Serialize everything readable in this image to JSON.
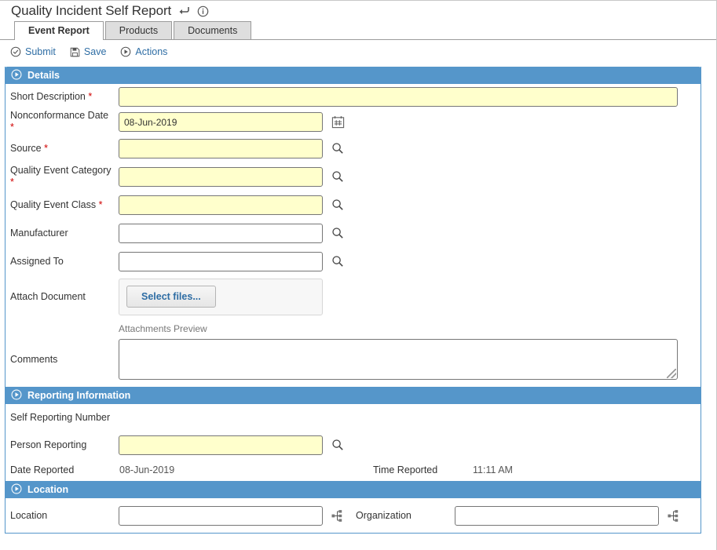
{
  "header": {
    "title": "Quality Incident Self Report",
    "icons": [
      {
        "name": "return-icon"
      },
      {
        "name": "info-icon"
      }
    ]
  },
  "tabs": [
    {
      "label": "Event Report",
      "active": true
    },
    {
      "label": "Products",
      "active": false
    },
    {
      "label": "Documents",
      "active": false
    }
  ],
  "toolbar": {
    "submit_label": "Submit",
    "save_label": "Save",
    "actions_label": "Actions"
  },
  "sections": {
    "details": {
      "title": "Details",
      "short_description": {
        "label": "Short Description",
        "required": true,
        "value": "",
        "picker": null
      },
      "nonconformance_date": {
        "label": "Nonconformance Date",
        "required": true,
        "value": "08-Jun-2019",
        "picker": "calendar-icon"
      },
      "source": {
        "label": "Source",
        "required": true,
        "value": "",
        "picker": "search-icon"
      },
      "quality_event_category": {
        "label": "Quality Event Category",
        "required": true,
        "value": "",
        "picker": "search-icon"
      },
      "quality_event_class": {
        "label": "Quality Event Class",
        "required": true,
        "value": "",
        "picker": "search-icon"
      },
      "manufacturer": {
        "label": "Manufacturer",
        "required": false,
        "value": "",
        "picker": "search-icon"
      },
      "assigned_to": {
        "label": "Assigned To",
        "required": false,
        "value": "",
        "picker": "search-icon"
      },
      "attach_document": {
        "label": "Attach Document",
        "button_label": "Select files..."
      },
      "attachments_preview": {
        "label": "Attachments Preview"
      },
      "comments": {
        "label": "Comments",
        "value": ""
      }
    },
    "reporting": {
      "title": "Reporting Information",
      "self_reporting_number": {
        "label": "Self Reporting Number",
        "value": ""
      },
      "person_reporting": {
        "label": "Person Reporting",
        "required": true,
        "value": "",
        "picker": "search-icon"
      },
      "date_reported": {
        "label": "Date Reported",
        "value": "08-Jun-2019"
      },
      "time_reported": {
        "label": "Time Reported",
        "value": "11:11 AM"
      }
    },
    "location": {
      "title": "Location",
      "location": {
        "label": "Location",
        "value": "",
        "picker": "tree-picker-icon"
      },
      "organization": {
        "label": "Organization",
        "value": "",
        "picker": "tree-picker-icon"
      }
    }
  },
  "colors": {
    "section_header_blue": "#5596ca",
    "required_field_yellow": "#ffffcc",
    "link_blue": "#2e6da4",
    "required_asterisk_red": "#d00000"
  }
}
